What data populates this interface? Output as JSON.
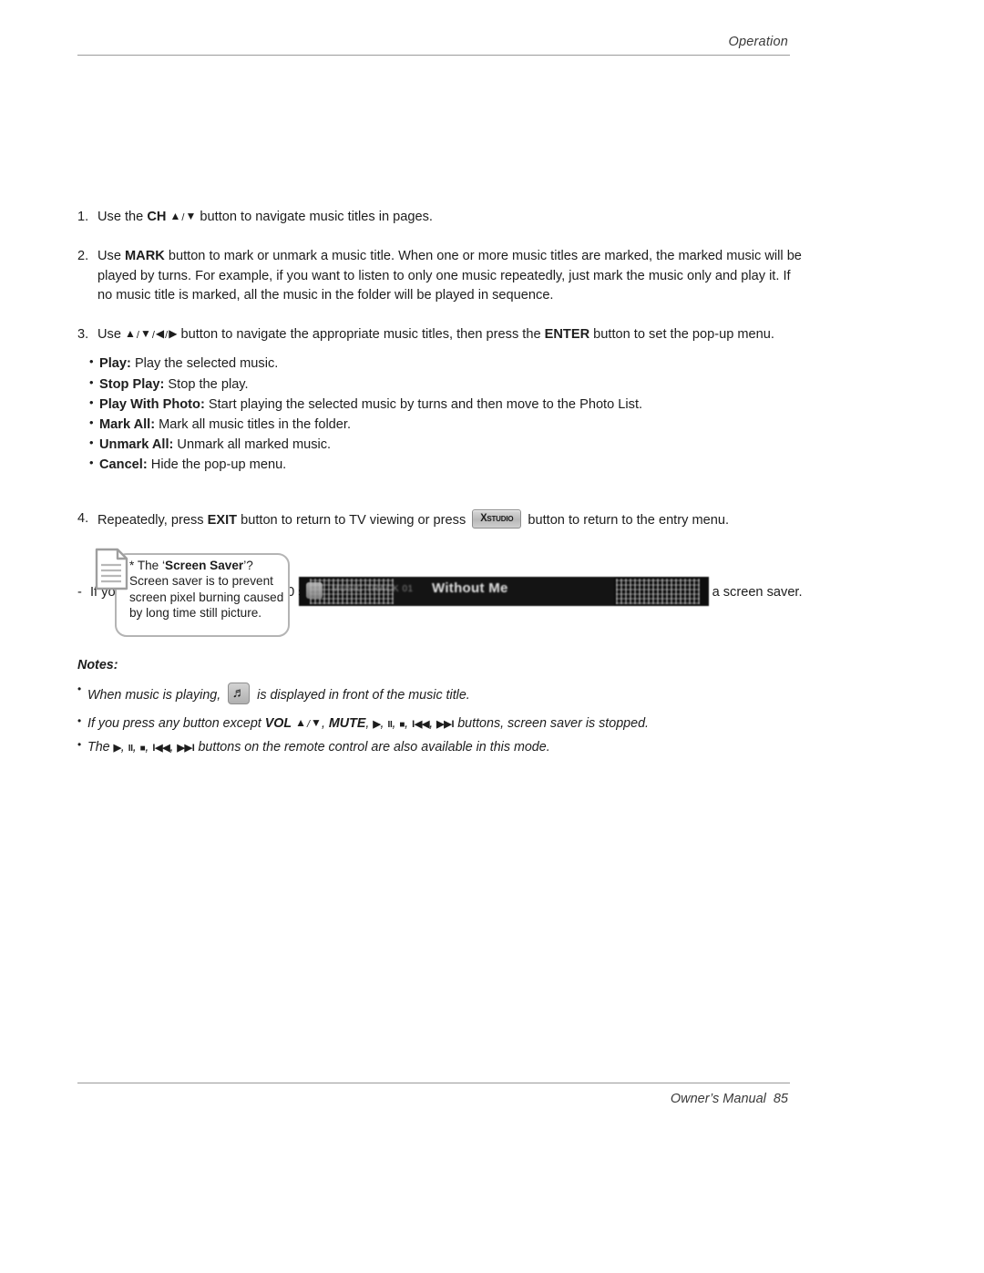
{
  "header": {
    "section_label": "Operation"
  },
  "steps": [
    {
      "marker": "1.",
      "pre": "Use the ",
      "bold1": "CH",
      "arrow_up": "▲",
      "slash": "/",
      "arrow_down": "▼",
      "post": " button to navigate music titles in pages."
    },
    {
      "marker": "2.",
      "pre": "Use ",
      "bold1": "MARK",
      "post": " button to mark or unmark a music title. When one or more music titles are marked, the marked music will be played by turns. For example, if you want to listen to only one music repeatedly, just mark the music only and play it. If no music title is marked, all the music in the folder  will be played in sequence."
    },
    {
      "marker": "3.",
      "pre": "Use ",
      "arrow_up": "▲",
      "arrow_down": "▼",
      "arrow_left": "◀",
      "arrow_right": "▶",
      "slash": "/",
      "mid": " button to navigate the appropriate music titles, then press the ",
      "bold1": "ENTER",
      "post": " button to set the pop-up  menu."
    },
    {
      "marker": "4.",
      "pre": "Repeatedly, press ",
      "bold1": "EXIT",
      "mid": " button to return to TV viewing or press ",
      "button_label_x": "X",
      "button_label_studio": "STUDIO",
      "post": " button to return to the entry menu."
    }
  ],
  "popup_menu": [
    {
      "label": "Play:",
      "desc": " Play the selected music."
    },
    {
      "label": "Stop Play:",
      "desc": " Stop the play."
    },
    {
      "label": "Play With Photo:",
      "desc": " Start playing the selected music by turns and then move to the Photo List."
    },
    {
      "label": "Mark All:",
      "desc": " Mark all music titles in the folder."
    },
    {
      "label": "Unmark All:",
      "desc": " Unmark all marked music."
    },
    {
      "label": "Cancel:",
      "desc": " Hide the pop-up menu."
    }
  ],
  "dash_note": {
    "marker": "-",
    "text": "If you don't press any button for 40 seconds, the play information box (as shown in the below) will float as a screen saver."
  },
  "callout": {
    "line1_pre": "* The ‘",
    "line1_bold": "Screen Saver",
    "line1_post": "’?",
    "body": "Screen saver is to prevent screen pixel burning caused by long time still picture."
  },
  "media_strip": {
    "meta_text": "MUSIC  TRACK  01",
    "title": "Without Me"
  },
  "notes": {
    "title": "Notes:",
    "note1_pre": "When music is playing, ",
    "note1_post": " is displayed in front of the music title.",
    "note2_pre": "If you press any button except ",
    "note2_vol": "VOL",
    "note2_arrow_up": "▲",
    "note2_slash": "/",
    "note2_arrow_down": "▼",
    "note2_mute": "MUTE",
    "note2_post": " buttons, screen saver is stopped.",
    "note3_pre": "The ",
    "note3_post": " buttons on the remote control are also available in this mode.",
    "transport": {
      "play": "▶",
      "pause": "II",
      "stop": "■",
      "prev": "I◀◀",
      "next": "▶▶I"
    }
  },
  "footer": {
    "label": "Owner’s Manual",
    "page": "85"
  },
  "colors": {
    "text": "#1d1d1d",
    "rule": "#9a9a9a",
    "callout_border": "#b4b4b4",
    "strip_bg": "#0e0e0e"
  }
}
